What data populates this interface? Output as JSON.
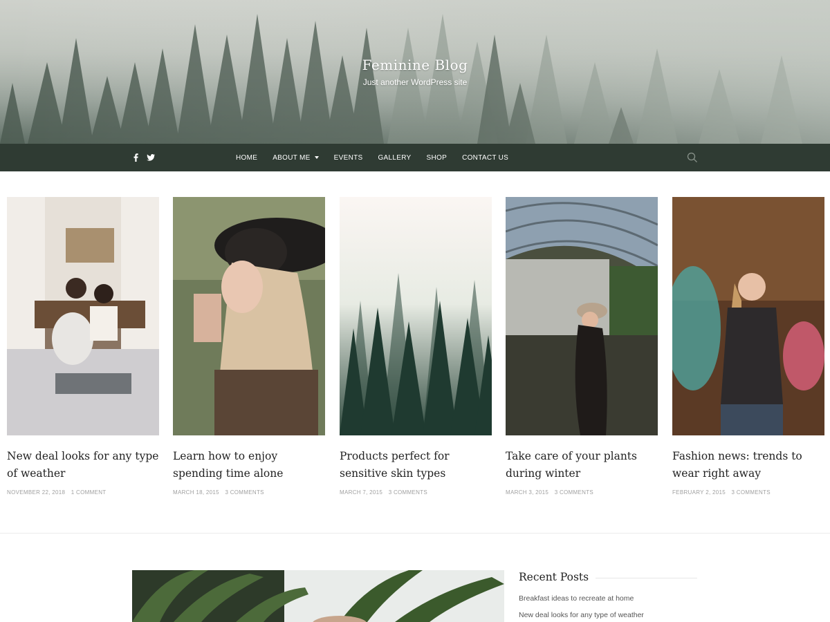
{
  "site": {
    "title": "Feminine Blog",
    "tagline": "Just another WordPress site"
  },
  "nav": {
    "social": [
      {
        "icon": "facebook-icon"
      },
      {
        "icon": "twitter-icon"
      }
    ],
    "items": [
      {
        "label": "HOME"
      },
      {
        "label": "ABOUT ME",
        "has_submenu": true
      },
      {
        "label": "EVENTS"
      },
      {
        "label": "GALLERY"
      },
      {
        "label": "SHOP"
      },
      {
        "label": "CONTACT US"
      }
    ],
    "search_icon": "search-icon",
    "background": "#2f3b33"
  },
  "posts": [
    {
      "title": "New deal looks for any type of weather",
      "date": "NOVEMBER 22, 2018",
      "comments": "1 COMMENT"
    },
    {
      "title": "Learn how to enjoy spending time alone",
      "date": "MARCH 18, 2015",
      "comments": "3 COMMENTS"
    },
    {
      "title": "Products perfect for sensitive skin types",
      "date": "MARCH 7, 2015",
      "comments": "3 COMMENTS"
    },
    {
      "title": "Take care of your plants during winter",
      "date": "MARCH 3, 2015",
      "comments": "3 COMMENTS"
    },
    {
      "title": "Fashion news: trends to wear right away",
      "date": "FEBRUARY 2, 2015",
      "comments": "3 COMMENTS"
    }
  ],
  "sidebar": {
    "recent_title": "Recent Posts",
    "recent": [
      "Breakfast ideas to recreate at home",
      "New deal looks for any type of weather"
    ]
  }
}
